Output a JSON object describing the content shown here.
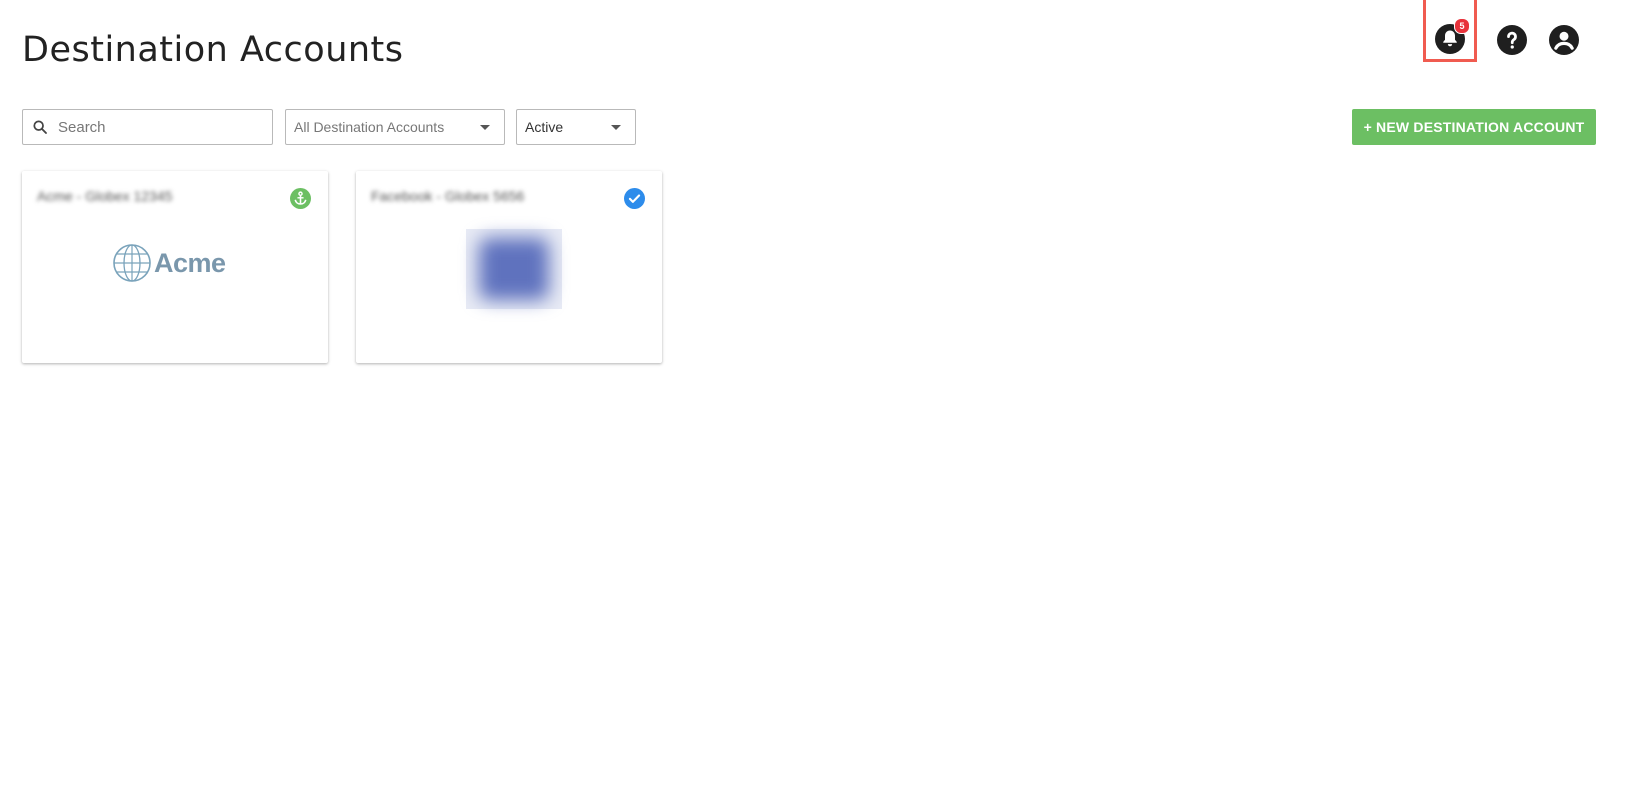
{
  "page": {
    "title": "Destination Accounts"
  },
  "header": {
    "notifications_count": "5",
    "icons": [
      "bell-icon",
      "help-icon",
      "account-icon"
    ]
  },
  "toolbar": {
    "search_placeholder": "Search",
    "accounts_filter_value": "All Destination Accounts",
    "status_filter_value": "Active",
    "new_button_label": "+ NEW DESTINATION ACCOUNT"
  },
  "cards": [
    {
      "title": "Acme - Globex 12345",
      "logo_text": "Acme",
      "status_icon": "anchor-icon",
      "status_color": "#6cbf63"
    },
    {
      "title": "Facebook - Globex 5656",
      "logo_text": "",
      "status_icon": "check-circle-icon",
      "status_color": "#2d8ceb"
    }
  ],
  "colors": {
    "primary_button": "#6cbf63",
    "highlight_border": "#f05b50",
    "badge": "#e8333b",
    "check_blue": "#2d8ceb"
  }
}
